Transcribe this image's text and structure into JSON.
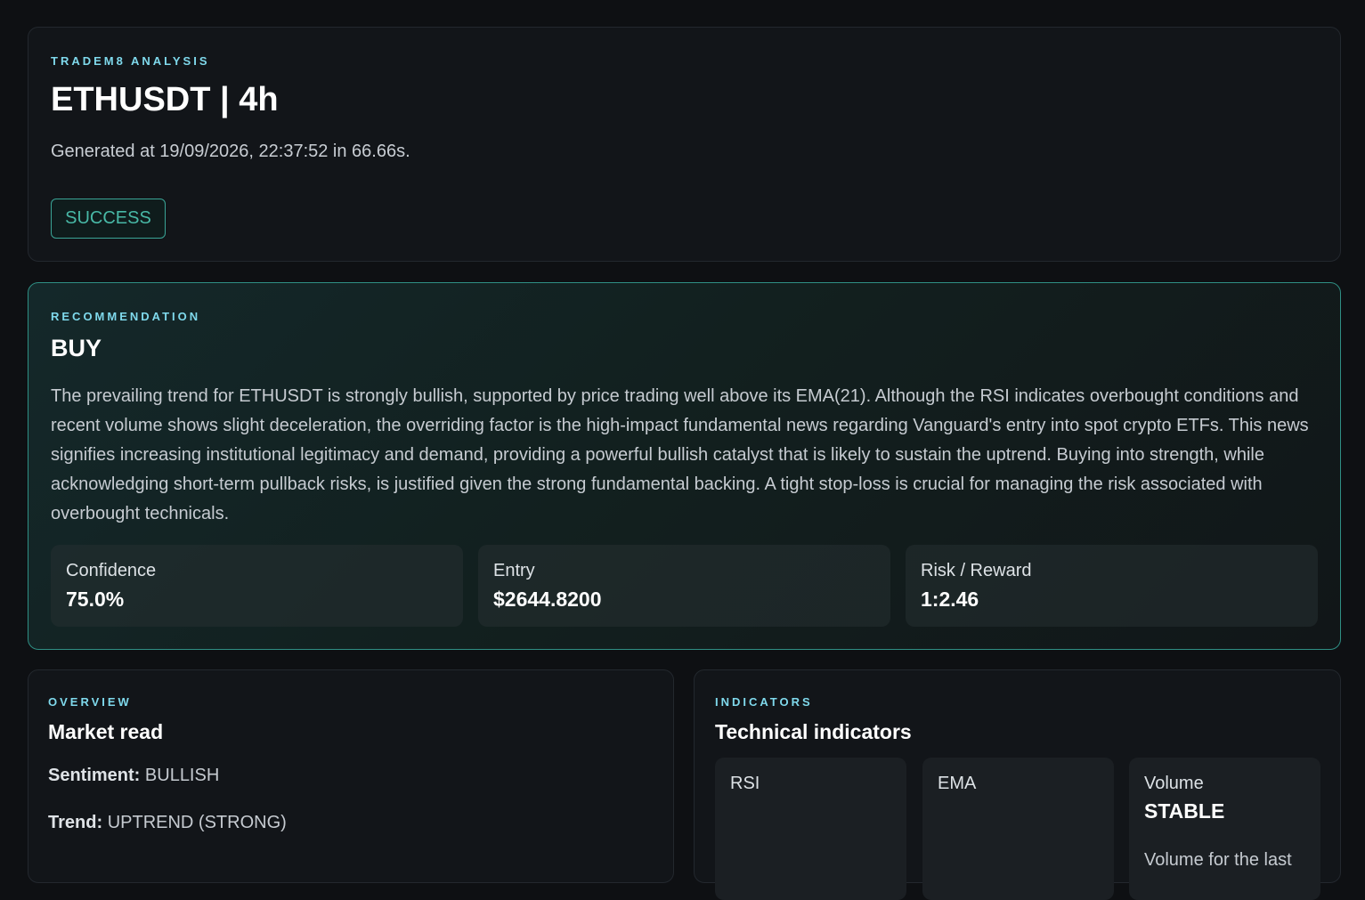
{
  "header": {
    "eyebrow": "TRADEM8 ANALYSIS",
    "title": "ETHUSDT | 4h",
    "generated": "Generated at 19/09/2026, 22:37:52 in 66.66s.",
    "status": "SUCCESS"
  },
  "recommendation": {
    "eyebrow": "RECOMMENDATION",
    "action": "BUY",
    "rationale": "The prevailing trend for ETHUSDT is strongly bullish, supported by price trading well above its EMA(21). Although the RSI indicates overbought conditions and recent volume shows slight deceleration, the overriding factor is the high-impact fundamental news regarding Vanguard's entry into spot crypto ETFs. This news signifies increasing institutional legitimacy and demand, providing a powerful bullish catalyst that is likely to sustain the uptrend. Buying into strength, while acknowledging short-term pullback risks, is justified given the strong fundamental backing. A tight stop-loss is crucial for managing the risk associated with overbought technicals.",
    "metrics": [
      {
        "label": "Confidence",
        "value": "75.0%"
      },
      {
        "label": "Entry",
        "value": "$2644.8200"
      },
      {
        "label": "Risk / Reward",
        "value": "1:2.46"
      }
    ]
  },
  "overview": {
    "eyebrow": "OVERVIEW",
    "title": "Market read",
    "sentiment_label": "Sentiment:",
    "sentiment_value": "BULLISH",
    "trend_label": "Trend:",
    "trend_value": "UPTREND (STRONG)"
  },
  "indicators": {
    "eyebrow": "INDICATORS",
    "title": "Technical indicators",
    "items": [
      {
        "label": "RSI",
        "value": "",
        "note": ""
      },
      {
        "label": "EMA",
        "value": "",
        "note": ""
      },
      {
        "label": "Volume",
        "value": "STABLE",
        "note": "Volume for the last"
      }
    ]
  },
  "colors": {
    "accent": "#7fd9ec",
    "success": "#48b8a6",
    "background": "#0e1013"
  }
}
